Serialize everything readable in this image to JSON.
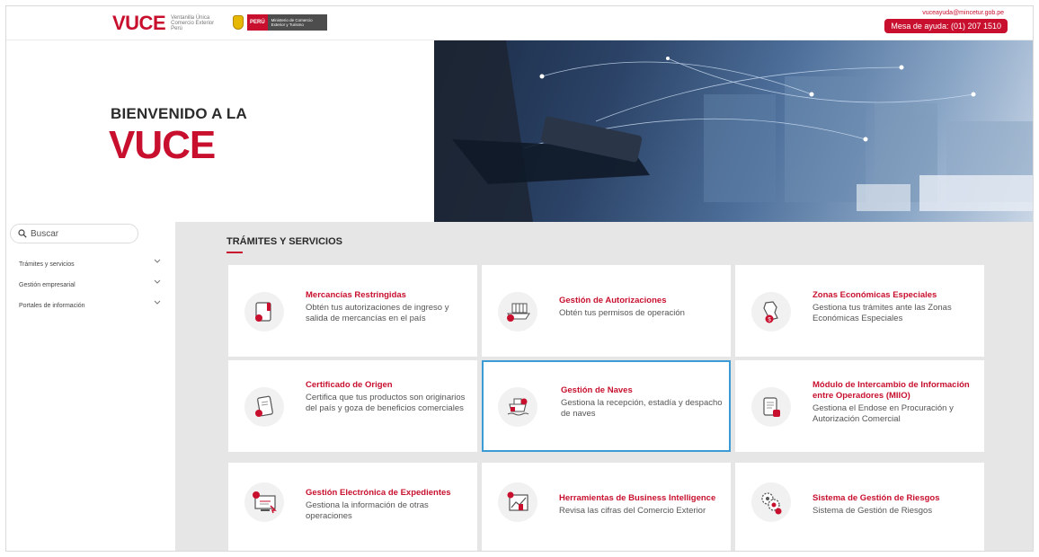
{
  "header": {
    "logo_mark": "VUCE",
    "logo_subtitle": "Ventanilla Única Comercio Exterior Perú",
    "gov_country": "PERÚ",
    "gov_ministry": "Ministerio de Comercio Exterior y Turismo",
    "help_email": "vuceayuda@mincetur.gob.pe",
    "help_phone": "Mesa de ayuda: (01) 207 1510"
  },
  "hero": {
    "title": "BIENVENIDO A LA",
    "logo": "VUCE"
  },
  "sidebar": {
    "search_placeholder": "Buscar",
    "items": [
      {
        "label": "Trámites y servicios"
      },
      {
        "label": "Gestión empresarial"
      },
      {
        "label": "Portales de información"
      }
    ]
  },
  "main": {
    "section_title": "TRÁMITES Y SERVICIOS",
    "cards": [
      {
        "title": "Mercancías Restringidas",
        "desc": "Obtén tus autorizaciones de ingreso y salida de mercancías en el país",
        "icon": "book-icon"
      },
      {
        "title": "Gestión de Autorizaciones",
        "desc": "Obtén tus permisos de operación",
        "icon": "ship-cargo-icon"
      },
      {
        "title": "Zonas Económicas Especiales",
        "desc": "Gestiona tus trámites ante las Zonas Económicas Especiales",
        "icon": "map-peru-icon"
      },
      {
        "title": "Certificado de Origen",
        "desc": "Certifica que tus productos son originarios del país y goza de beneficios comerciales",
        "icon": "certificate-icon"
      },
      {
        "title": "Gestión de Naves",
        "desc": "Gestiona la recepción, estadía y despacho de naves",
        "icon": "ship-icon"
      },
      {
        "title": "Módulo de Intercambio de Información entre Operadores (MIIO)",
        "desc": "Gestiona el Endose en Procuración y Autorización Comercial",
        "icon": "document-exchange-icon"
      },
      {
        "title": "Gestión Electrónica de Expedientes",
        "desc": "Gestiona la información de otras operaciones",
        "icon": "computer-icon"
      },
      {
        "title": "Herramientas de Business Intelligence",
        "desc": "Revisa las cifras del Comercio Exterior",
        "icon": "chart-icon"
      },
      {
        "title": "Sistema de Gestión de Riesgos",
        "desc": "Sistema de Gestión de Riesgos",
        "icon": "gears-icon"
      }
    ]
  },
  "colors": {
    "brand_red": "#c8102e",
    "highlight_border": "#3a9bd5",
    "main_bg": "#e6e6e6"
  }
}
